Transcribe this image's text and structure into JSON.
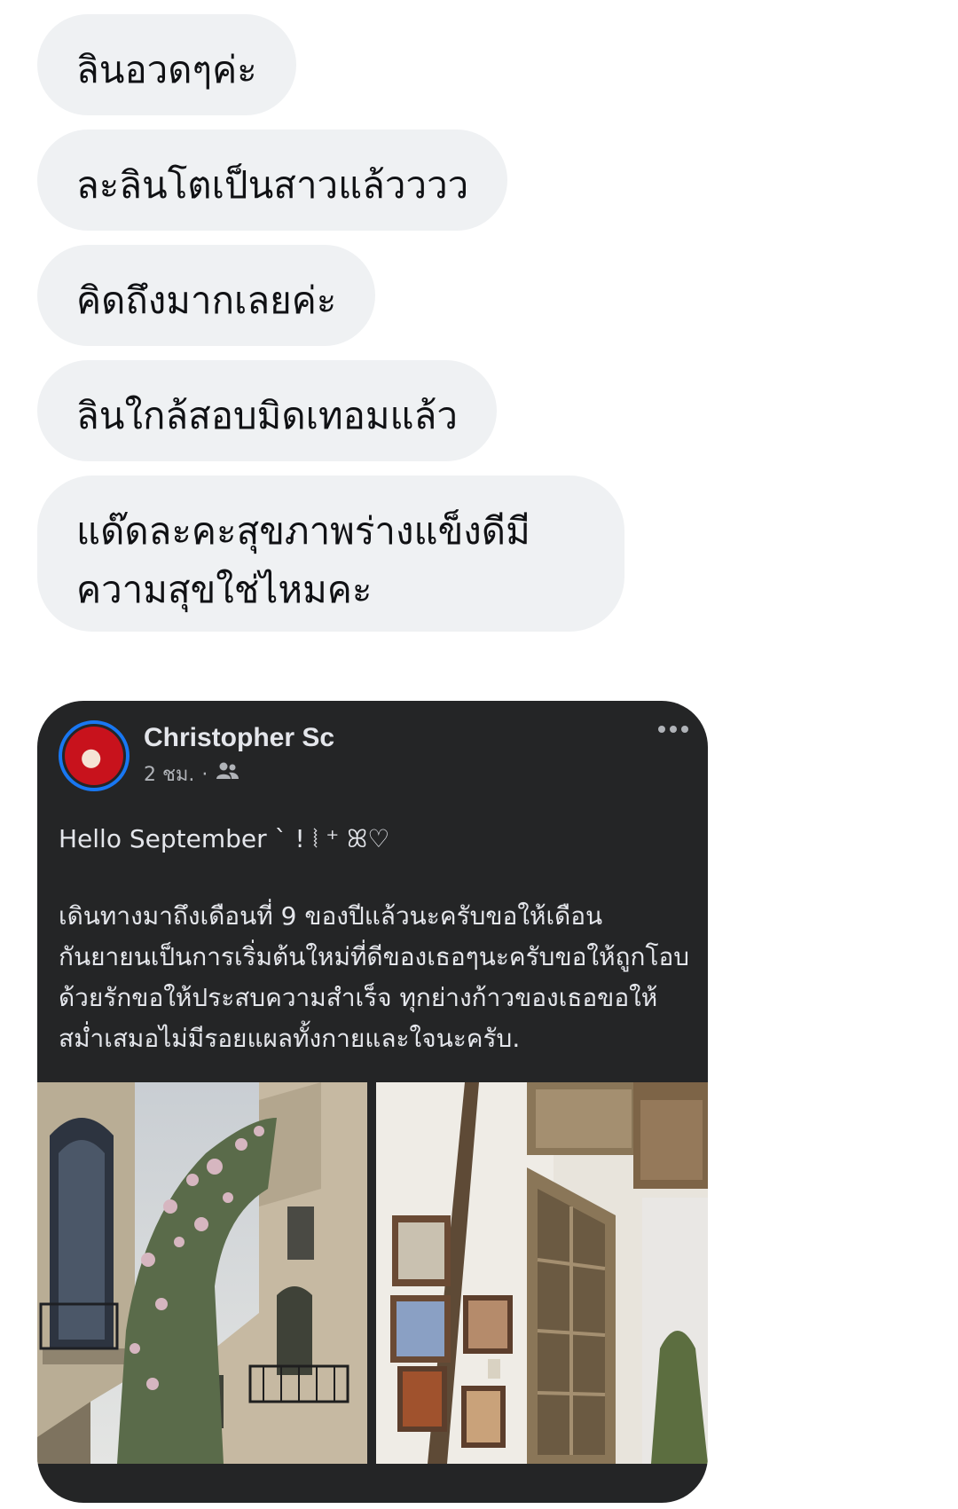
{
  "messages": [
    {
      "text": "ลินอวดๆค่ะ"
    },
    {
      "text": "ละลินโตเป็นสาวแล้วววว"
    },
    {
      "text": "คิดถึงมากเลยค่ะ"
    },
    {
      "text": "ลินใกล้สอบมิดเทอมแล้ว"
    },
    {
      "text": "แด๊ดละคะสุขภาพร่างแข็งดีมีความสุขใช่ไหมคะ"
    }
  ],
  "shared_post": {
    "author": "Christopher Sc",
    "time": "2 ชม.",
    "separator": "·",
    "audience_icon": "friends-icon",
    "greeting": "Hello September ˋ ! ⦚ ⁺ ꕤ♡",
    "body": "เดินทางมาถึงเดือนที่ 9 ของปีแล้วนะครับขอให้เดือนกันยายนเป็นการเริ่มต้นใหม่ที่ดีของเธอๆนะครับขอให้ถูกโอบด้วยรักขอให้ประสบความสำเร็จ ทุกย่างก้าวของเธอขอให้สม่ำเสมอไม่มีรอยแผลทั้งกายและใจนะครับ.",
    "photos": [
      "building-with-flowering-vine-photo",
      "white-wall-frames-and-wooden-door-photo"
    ]
  },
  "colors": {
    "bubble": "#eff1f3",
    "post_background": "#242526",
    "text_light": "#e4e6eb",
    "text_muted": "#b0b3b8",
    "avatar_ring": "#1877f2"
  }
}
